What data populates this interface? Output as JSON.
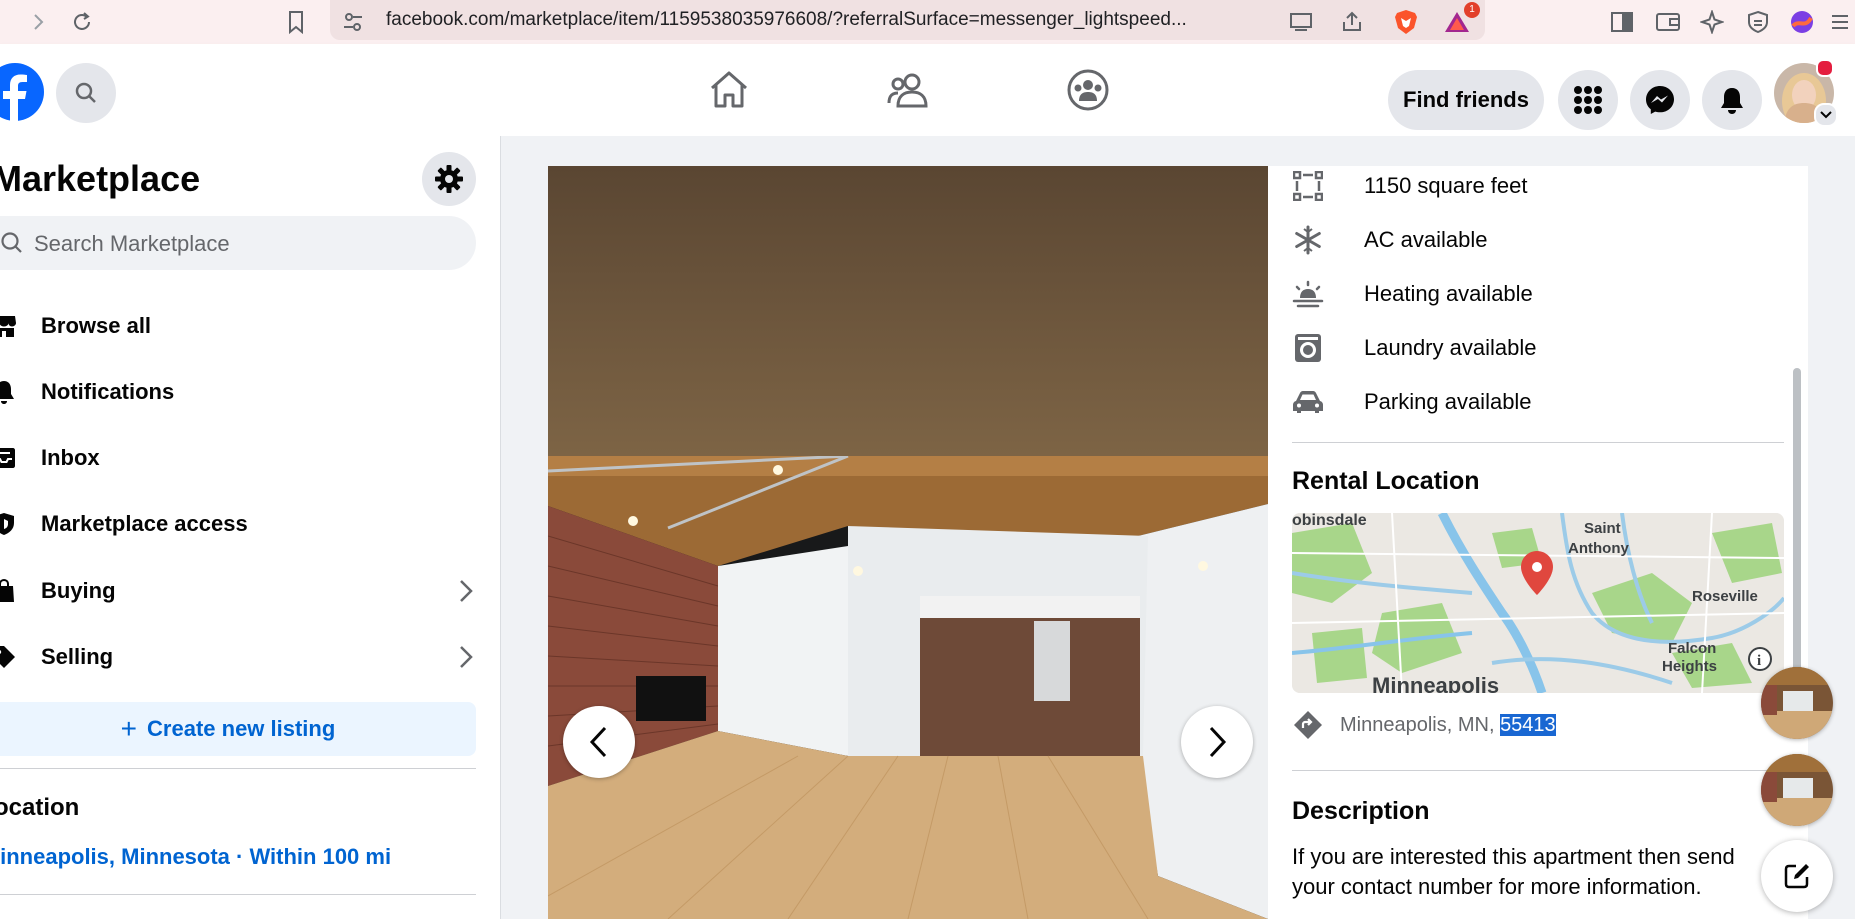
{
  "browser": {
    "url": "facebook.com/marketplace/item/1159538035976608/?referralSurface=messenger_lightspeed...",
    "notification_count": "1"
  },
  "header": {
    "find_friends_label": "Find friends"
  },
  "sidebar": {
    "title": "Marketplace",
    "search_placeholder": "Search Marketplace",
    "items": [
      {
        "label": "Browse all",
        "icon": "storefront-icon"
      },
      {
        "label": "Notifications",
        "icon": "bell-icon"
      },
      {
        "label": "Inbox",
        "icon": "inbox-icon"
      },
      {
        "label": "Marketplace access",
        "icon": "shield-icon"
      },
      {
        "label": "Buying",
        "icon": "shopping-bag-icon"
      },
      {
        "label": "Selling",
        "icon": "tag-icon"
      }
    ],
    "create_label": "Create new listing",
    "location_title": "ocation",
    "location_value": "linneapolis, Minnesota · Within 100 mi"
  },
  "listing": {
    "features": [
      {
        "text": "1150 square feet",
        "icon": "square-footage-icon"
      },
      {
        "text": "AC available",
        "icon": "snowflake-icon"
      },
      {
        "text": "Heating available",
        "icon": "heating-icon"
      },
      {
        "text": "Laundry available",
        "icon": "washer-icon"
      },
      {
        "text": "Parking available",
        "icon": "car-icon"
      }
    ],
    "rental_location_title": "Rental Location",
    "map_labels": {
      "robbinsdale": "obinsdale",
      "saint_anthony": "Saint Anthony",
      "roseville": "Roseville",
      "falcon_heights": "Falcon Heights",
      "minneapolis": "Minneapolis"
    },
    "address_prefix": "Minneapolis, MN, ",
    "address_zip": "55413",
    "description_title": "Description",
    "description_text": "If you are interested this apartment then send your contact number for more information."
  },
  "colors": {
    "fb_blue": "#0866ff",
    "link_blue": "#0064d1",
    "selection": "#1967d2"
  }
}
